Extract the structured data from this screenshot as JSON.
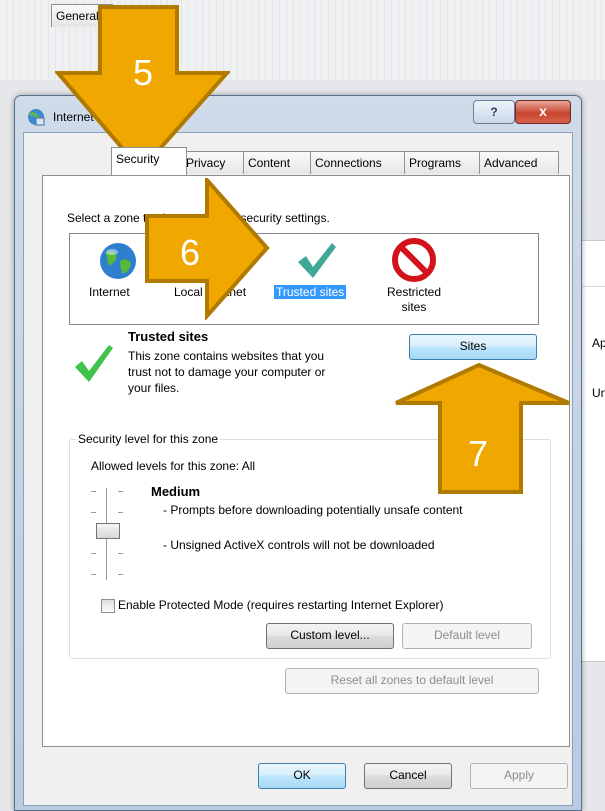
{
  "dialog": {
    "title": "Internet Options",
    "help_icon": "?",
    "close_icon": "x"
  },
  "tabs": [
    "General",
    "Security",
    "Privacy",
    "Content",
    "Connections",
    "Programs",
    "Advanced"
  ],
  "security": {
    "select_zone_text": "Select a zone to view or change security settings.",
    "zones": [
      {
        "label": "Internet",
        "icon": "globe-icon"
      },
      {
        "label": "Local intranet",
        "icon": "intranet-icon"
      },
      {
        "label": "Trusted sites",
        "icon": "checkmark-icon",
        "selected": true
      },
      {
        "label": "Restricted sites",
        "icon": "restricted-icon"
      }
    ],
    "zone_title": "Trusted sites",
    "zone_description": "This zone contains websites that you trust not to damage your computer or your files.",
    "sites_button": "Sites",
    "level_group_title": "Security level for this zone",
    "allowed_levels": "Allowed levels for this zone: All",
    "level_name": "Medium",
    "level_details": [
      "- Prompts before downloading potentially unsafe content",
      "- Unsigned ActiveX controls will not be downloaded"
    ],
    "protected_mode_label": "Enable Protected Mode (requires restarting Internet Explorer)",
    "protected_mode_checked": false,
    "custom_level_button": "Custom level...",
    "default_level_button": "Default level",
    "reset_all_button": "Reset all zones to default level"
  },
  "footer": {
    "ok": "OK",
    "cancel": "Cancel",
    "apply": "Apply"
  },
  "annotations": {
    "step5": "5",
    "step6": "6",
    "step7": "7",
    "color": "#f0a800"
  },
  "background_window": {
    "text1": "Ap",
    "text2": "Un"
  }
}
